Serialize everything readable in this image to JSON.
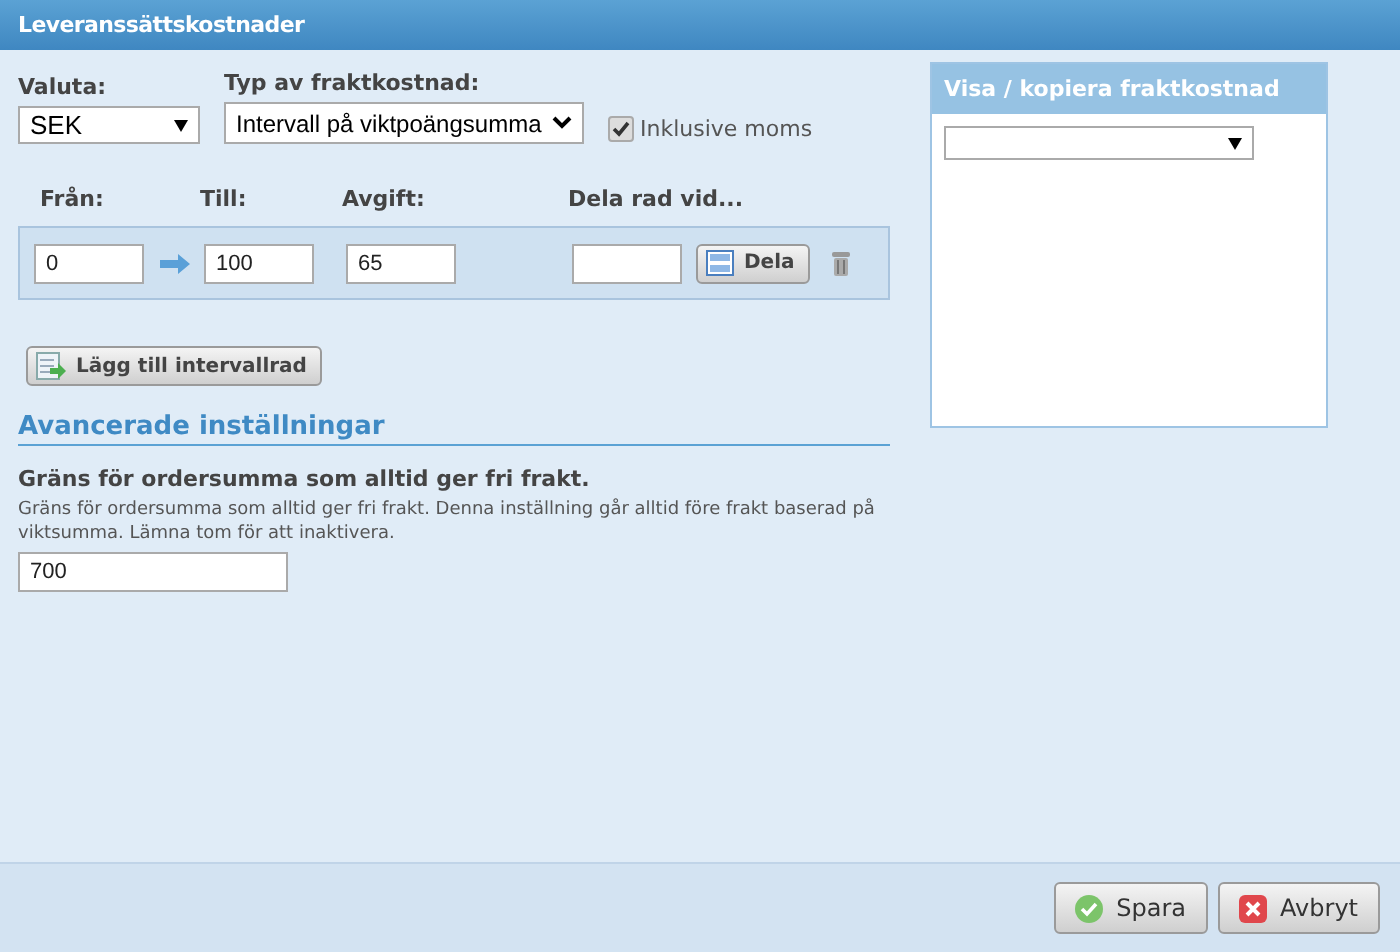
{
  "window": {
    "title": "Leveranssättskostnader"
  },
  "currency": {
    "label": "Valuta:",
    "value": "SEK"
  },
  "cost_type": {
    "label": "Typ av fraktkostnad:",
    "value": "Intervall på viktpoängsumma"
  },
  "inclusive_vat": {
    "label": "Inklusive moms",
    "checked": true
  },
  "interval_table": {
    "columns": [
      "Från:",
      "Till:",
      "Avgift:",
      "Dela rad vid..."
    ],
    "rows": [
      {
        "from": "0",
        "to": "100",
        "fee": "65",
        "split_at": "",
        "split_button": "Dela"
      }
    ]
  },
  "add_row_button": "Lägg till intervallrad",
  "advanced": {
    "heading": "Avancerade inställningar",
    "label": "Gräns för ordersumma som alltid ger fri frakt.",
    "help": "Gräns för ordersumma som alltid ger fri frakt. Denna inställning går alltid före frakt baserad på viktsumma. Lämna tom för att inaktivera.",
    "value": "700"
  },
  "side_panel": {
    "title": "Visa / kopiera fraktkostnad"
  },
  "buttons": [
    {
      "label": "Spara",
      "kind": "save"
    },
    {
      "label": "Avbryt",
      "kind": "cancel"
    }
  ]
}
